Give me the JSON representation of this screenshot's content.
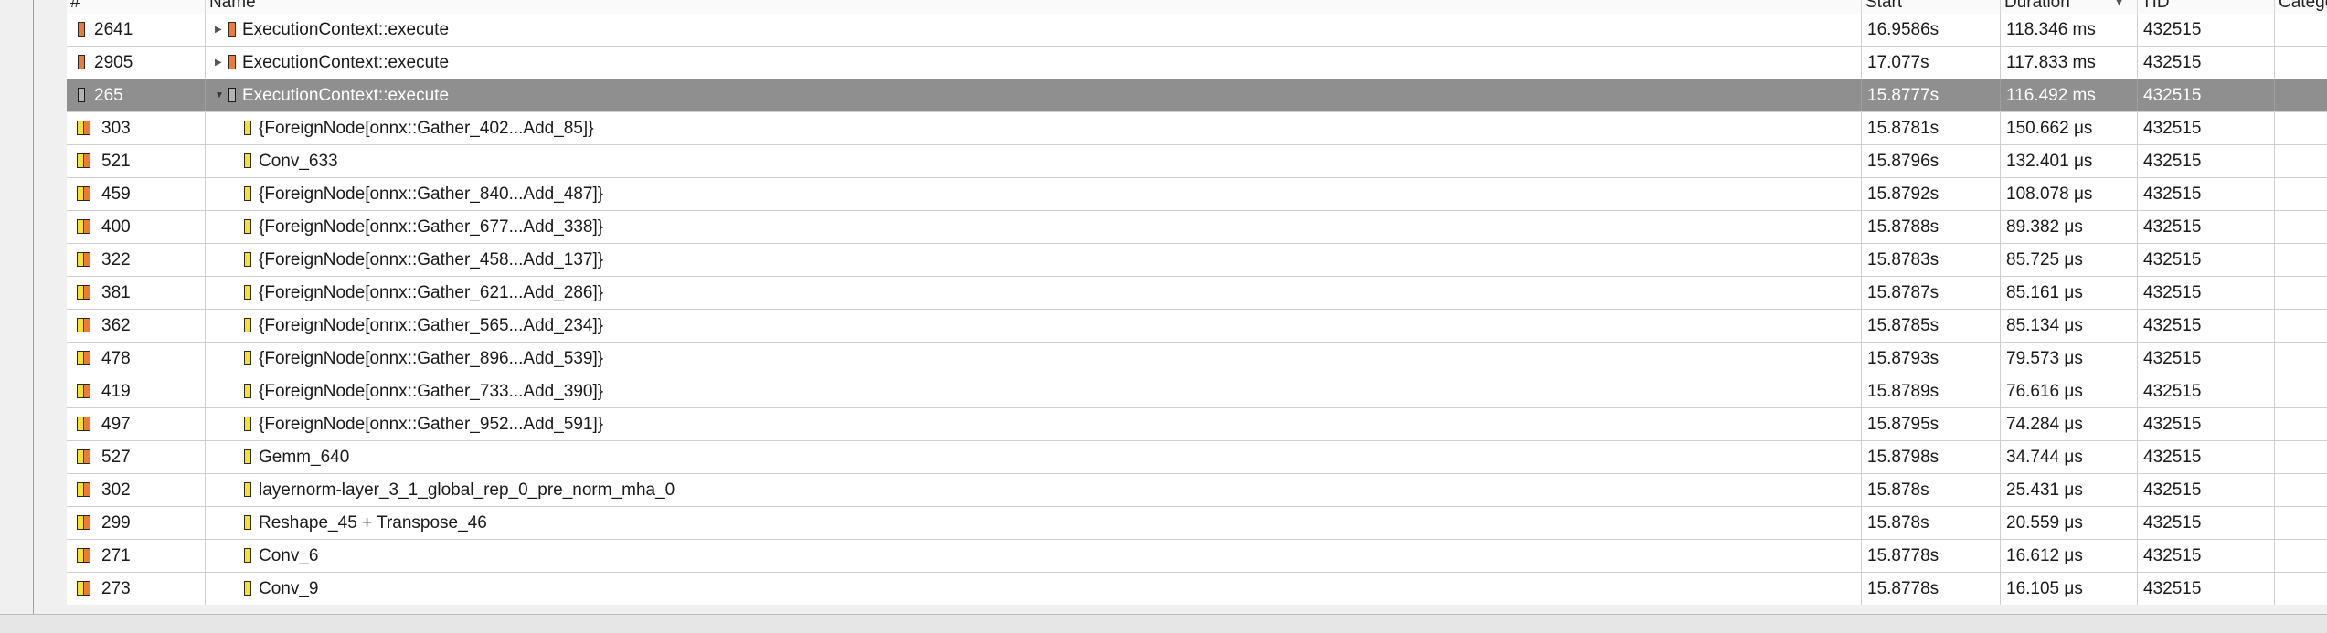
{
  "header": {
    "columns": [
      "#",
      "Name",
      "Start",
      "Duration",
      "TID",
      "Category"
    ]
  },
  "rows": [
    {
      "id": "2641",
      "name": "ExecutionContext::execute",
      "start": "16.9586s",
      "duration": "118.346 ms",
      "tid": "432515",
      "level": 0,
      "expander": "collapsed",
      "icon": "orange-range-icon"
    },
    {
      "id": "2905",
      "name": "ExecutionContext::execute",
      "start": "17.077s",
      "duration": "117.833 ms",
      "tid": "432515",
      "level": 0,
      "expander": "collapsed",
      "icon": "orange-range-icon"
    },
    {
      "id": "265",
      "name": "ExecutionContext::execute",
      "start": "15.8777s",
      "duration": "116.492 ms",
      "tid": "432515",
      "level": 0,
      "expander": "expanded",
      "icon": "orange-range-icon",
      "selected": true
    },
    {
      "id": "303",
      "name": "{ForeignNode[onnx::Gather_402...Add_85]}",
      "start": "15.8781s",
      "duration": "150.662 μs",
      "tid": "432515",
      "level": 1,
      "icon": "yellow-range-icon"
    },
    {
      "id": "521",
      "name": "Conv_633",
      "start": "15.8796s",
      "duration": "132.401 μs",
      "tid": "432515",
      "level": 1,
      "icon": "yellow-range-icon"
    },
    {
      "id": "459",
      "name": "{ForeignNode[onnx::Gather_840...Add_487]}",
      "start": "15.8792s",
      "duration": "108.078 μs",
      "tid": "432515",
      "level": 1,
      "icon": "yellow-range-icon"
    },
    {
      "id": "400",
      "name": "{ForeignNode[onnx::Gather_677...Add_338]}",
      "start": "15.8788s",
      "duration": "89.382 μs",
      "tid": "432515",
      "level": 1,
      "icon": "yellow-range-icon"
    },
    {
      "id": "322",
      "name": "{ForeignNode[onnx::Gather_458...Add_137]}",
      "start": "15.8783s",
      "duration": "85.725 μs",
      "tid": "432515",
      "level": 1,
      "icon": "yellow-range-icon"
    },
    {
      "id": "381",
      "name": "{ForeignNode[onnx::Gather_621...Add_286]}",
      "start": "15.8787s",
      "duration": "85.161 μs",
      "tid": "432515",
      "level": 1,
      "icon": "yellow-range-icon"
    },
    {
      "id": "362",
      "name": "{ForeignNode[onnx::Gather_565...Add_234]}",
      "start": "15.8785s",
      "duration": "85.134 μs",
      "tid": "432515",
      "level": 1,
      "icon": "yellow-range-icon"
    },
    {
      "id": "478",
      "name": "{ForeignNode[onnx::Gather_896...Add_539]}",
      "start": "15.8793s",
      "duration": "79.573 μs",
      "tid": "432515",
      "level": 1,
      "icon": "yellow-range-icon"
    },
    {
      "id": "419",
      "name": "{ForeignNode[onnx::Gather_733...Add_390]}",
      "start": "15.8789s",
      "duration": "76.616 μs",
      "tid": "432515",
      "level": 1,
      "icon": "yellow-range-icon"
    },
    {
      "id": "497",
      "name": "{ForeignNode[onnx::Gather_952...Add_591]}",
      "start": "15.8795s",
      "duration": "74.284 μs",
      "tid": "432515",
      "level": 1,
      "icon": "yellow-range-icon"
    },
    {
      "id": "527",
      "name": "Gemm_640",
      "start": "15.8798s",
      "duration": "34.744 μs",
      "tid": "432515",
      "level": 1,
      "icon": "yellow-range-icon"
    },
    {
      "id": "302",
      "name": "layernorm-layer_3_1_global_rep_0_pre_norm_mha_0",
      "start": "15.878s",
      "duration": "25.431 μs",
      "tid": "432515",
      "level": 1,
      "icon": "yellow-range-icon"
    },
    {
      "id": "299",
      "name": "Reshape_45 + Transpose_46",
      "start": "15.878s",
      "duration": "20.559 μs",
      "tid": "432515",
      "level": 1,
      "icon": "yellow-range-icon"
    },
    {
      "id": "271",
      "name": "Conv_6",
      "start": "15.8778s",
      "duration": "16.612 μs",
      "tid": "432515",
      "level": 1,
      "icon": "yellow-range-icon"
    },
    {
      "id": "273",
      "name": "Conv_9",
      "start": "15.8778s",
      "duration": "16.105 μs",
      "tid": "432515",
      "level": 1,
      "icon": "yellow-range-icon"
    }
  ],
  "colors": {
    "selection": "#8f8f8f",
    "orange": "#ee7a3a",
    "yellow": "#f7e12a"
  }
}
